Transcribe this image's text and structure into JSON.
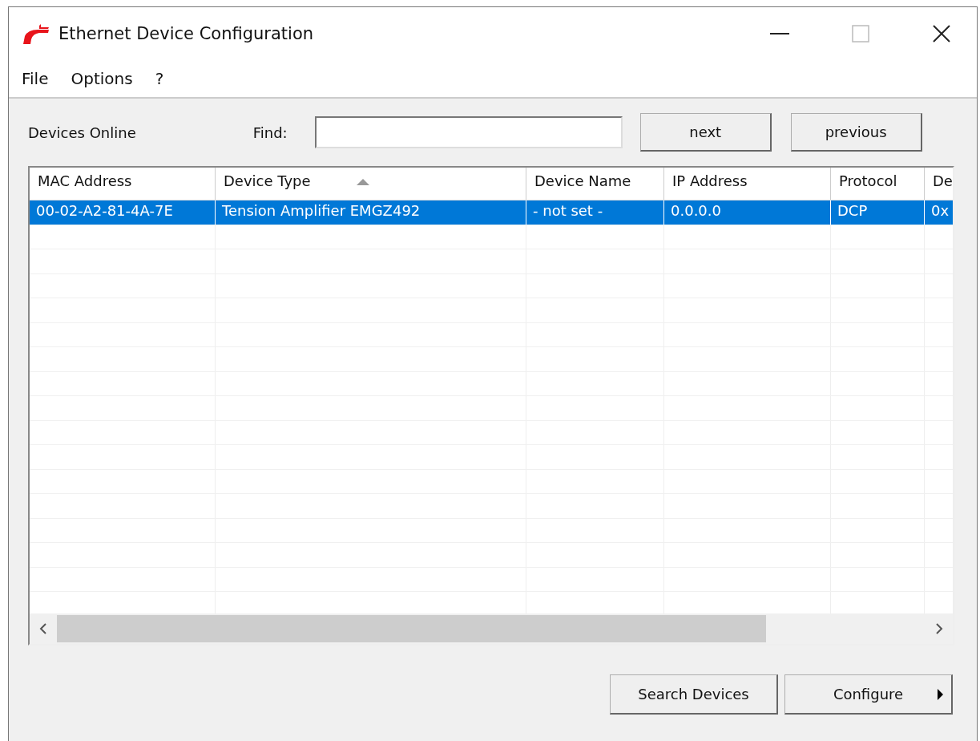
{
  "window": {
    "title": "Ethernet Device Configuration"
  },
  "menu": [
    {
      "label": "File"
    },
    {
      "label": "Options"
    },
    {
      "label": "?"
    }
  ],
  "devices_label": "Devices Online",
  "find": {
    "label": "Find:"
  },
  "find_buttons": [
    "next",
    "previous"
  ],
  "table": {
    "columns": [
      {
        "label": "MAC Address",
        "sorted": false
      },
      {
        "label": "Device Type",
        "sorted": true
      },
      {
        "label": "Device Name",
        "sorted": false
      },
      {
        "label": "IP Address",
        "sorted": false
      },
      {
        "label": "Protocol",
        "sorted": false
      },
      {
        "label": "De",
        "sorted": false
      }
    ],
    "rows": [
      {
        "selected": true,
        "cells": [
          "00-02-A2-81-4A-7E",
          "Tension Amplifier EMGZ492",
          "- not set -",
          "0.0.0.0",
          "DCP",
          "0x"
        ]
      }
    ]
  },
  "buttons": [
    {
      "label": "Search Devices",
      "kind": "plain"
    },
    {
      "label": "Configure",
      "kind": "split"
    }
  ]
}
